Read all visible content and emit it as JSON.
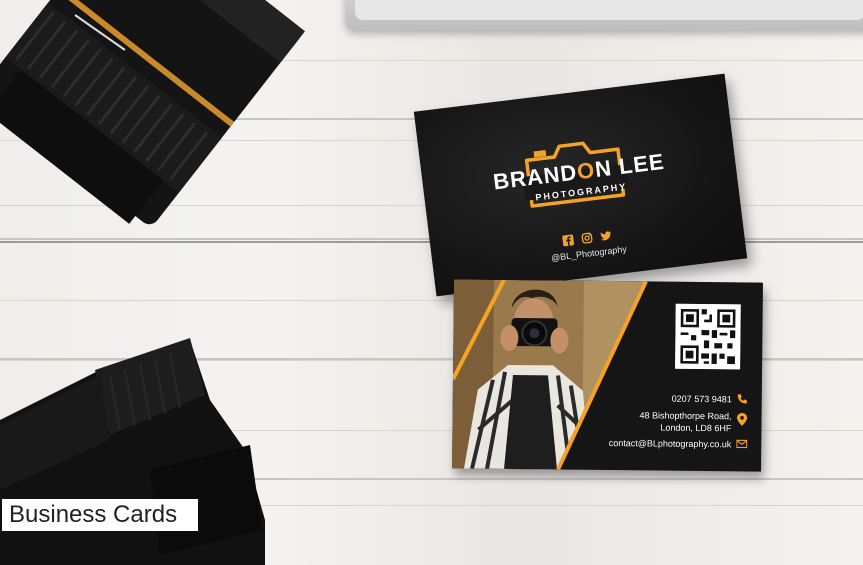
{
  "caption": "Business Cards",
  "card_front": {
    "brand_first": "BRAND",
    "brand_accent": "O",
    "brand_last": "N LEE",
    "tagline": "PHOTOGRAPHY",
    "handle": "@BL_Photography",
    "social_icons": [
      "facebook-icon",
      "instagram-icon",
      "twitter-icon"
    ]
  },
  "card_back": {
    "phone": "0207 573 9481",
    "address_line1": "48 Bishopthorpe Road,",
    "address_line2": "London, LD8 6HF",
    "email": "contact@BLphotography.co.uk",
    "icons": [
      "phone-icon",
      "location-pin-icon",
      "mail-icon",
      "qr-code"
    ]
  },
  "colors": {
    "accent": "#f4a326",
    "card": "#161616"
  }
}
